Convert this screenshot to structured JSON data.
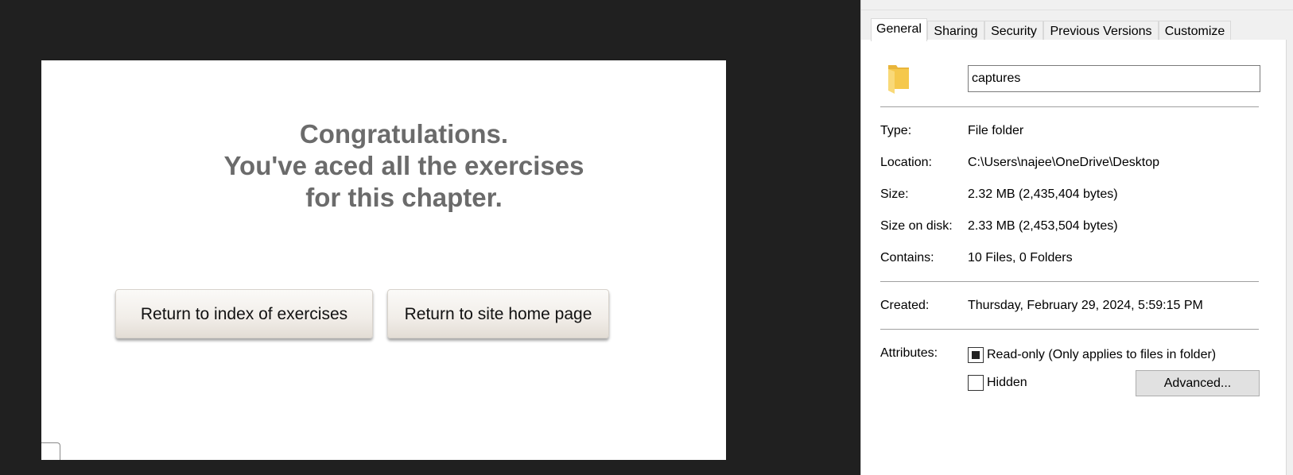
{
  "exercise_page": {
    "message_lines": [
      "Congratulations.",
      "You've aced all the exercises",
      "for this chapter."
    ],
    "buttons": {
      "index": "Return to index of exercises",
      "home": "Return to site home page"
    }
  },
  "properties_dialog": {
    "tabs": [
      "General",
      "Sharing",
      "Security",
      "Previous Versions",
      "Customize"
    ],
    "active_tab": "General",
    "folder_name": "captures",
    "fields": {
      "type": {
        "label": "Type:",
        "value": "File folder"
      },
      "location": {
        "label": "Location:",
        "value": "C:\\Users\\najee\\OneDrive\\Desktop"
      },
      "size": {
        "label": "Size:",
        "value": "2.32 MB (2,435,404 bytes)"
      },
      "size_on_disk": {
        "label": "Size on disk:",
        "value": "2.33 MB (2,453,504 bytes)"
      },
      "contains": {
        "label": "Contains:",
        "value": "10 Files, 0 Folders"
      },
      "created": {
        "label": "Created:",
        "value": "Thursday, February 29, 2024, 5:59:15 PM"
      }
    },
    "attributes": {
      "label": "Attributes:",
      "readonly": {
        "label": "Read-only (Only applies to files in folder)",
        "state": "indeterminate"
      },
      "hidden": {
        "label": "Hidden",
        "state": "unchecked"
      },
      "advanced_button": "Advanced..."
    },
    "colors": {
      "folder_icon": "#f5c84c",
      "panel_bg": "#ffffff",
      "dialog_bg": "#f0f0f0"
    }
  }
}
